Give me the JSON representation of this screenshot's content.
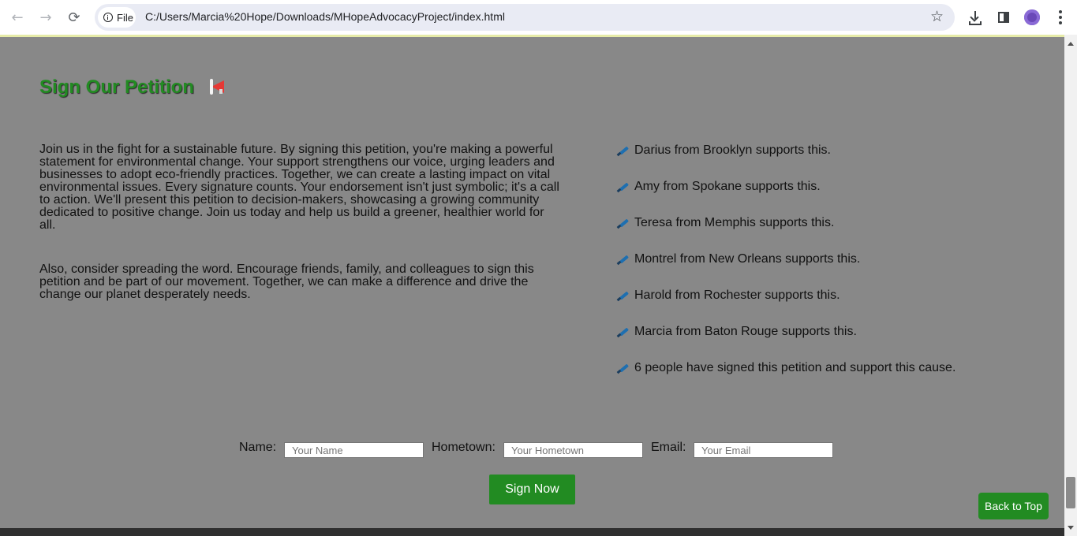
{
  "browser": {
    "back_label": "←",
    "forward_label": "→",
    "reload_label": "⟳",
    "site_chip": "File",
    "url": "C:/Users/Marcia%20Hope/Downloads/MHopeAdvocacyProject/index.html",
    "star_label": "☆",
    "icons": [
      "back-arrow-icon",
      "forward-arrow-icon",
      "reload-icon",
      "info-icon",
      "star-icon",
      "download-icon",
      "side-panel-icon",
      "profile-avatar",
      "more-menu-icon"
    ]
  },
  "section": {
    "title": "Sign Our Petition",
    "title_icon": "megaphone-icon",
    "title_color": "#228b22",
    "paragraphs": [
      "Join us in the fight for a sustainable future. By signing this petition, you're making a powerful statement for environmental change. Your support strengthens our voice, urging leaders and businesses to adopt eco-friendly practices. Together, we can create a lasting impact on vital environmental issues. Every signature counts. Your endorsement isn't just symbolic; it's a call to action. We'll present this petition to decision-makers, showcasing a growing community dedicated to positive change. Join us today and help us build a greener, healthier world for all.",
      "Also, consider spreading the word. Encourage friends, family, and colleagues to sign this petition and be part of our movement. Together, we can make a difference and drive the change our planet desperately needs."
    ],
    "supporters": [
      "Darius from Brooklyn supports this.",
      "Amy from Spokane supports this.",
      "Teresa from Memphis supports this.",
      "Montrel from New Orleans supports this.",
      "Harold from Rochester supports this.",
      "Marcia from Baton Rouge supports this.",
      "6 people have signed this petition and support this cause."
    ],
    "supporter_icon": "pen-icon"
  },
  "form": {
    "name_label": "Name:",
    "name_placeholder": "Your Name",
    "hometown_label": "Hometown:",
    "hometown_placeholder": "Your Hometown",
    "email_label": "Email:",
    "email_placeholder": "Your Email",
    "submit_label": "Sign Now"
  },
  "back_to_top_label": "Back to Top",
  "colors": {
    "page_background": "#888888",
    "button_green": "#228b22",
    "text": "#111111"
  }
}
